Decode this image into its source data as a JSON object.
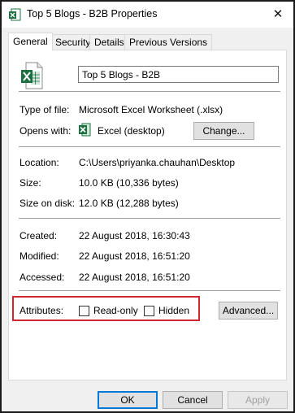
{
  "window": {
    "title": "Top 5 Blogs - B2B Properties",
    "close_glyph": "✕"
  },
  "tabs": [
    {
      "label": "General",
      "active": true
    },
    {
      "label": "Security",
      "active": false
    },
    {
      "label": "Details",
      "active": false
    },
    {
      "label": "Previous Versions",
      "active": false
    }
  ],
  "general": {
    "file_name": "Top 5 Blogs - B2B",
    "type_label": "Type of file:",
    "type_value": "Microsoft Excel Worksheet (.xlsx)",
    "opens_label": "Opens with:",
    "opens_value": "Excel (desktop)",
    "change_button": "Change...",
    "location_label": "Location:",
    "location_value": "C:\\Users\\priyanka.chauhan\\Desktop",
    "size_label": "Size:",
    "size_value": "10.0 KB (10,336 bytes)",
    "size_on_disk_label": "Size on disk:",
    "size_on_disk_value": "12.0 KB (12,288 bytes)",
    "created_label": "Created:",
    "created_value": "22 August 2018, 16:30:43",
    "modified_label": "Modified:",
    "modified_value": "22 August 2018, 16:51:20",
    "accessed_label": "Accessed:",
    "accessed_value": "22 August 2018, 16:51:20",
    "attributes_label": "Attributes:",
    "readonly_label": "Read-only",
    "readonly_checked": false,
    "hidden_label": "Hidden",
    "hidden_checked": false,
    "advanced_button": "Advanced..."
  },
  "footer": {
    "ok": "OK",
    "cancel": "Cancel",
    "apply": "Apply"
  },
  "icons": {
    "file": "excel-file-icon",
    "app": "excel-app-icon"
  },
  "colors": {
    "excel_green": "#1d6f42",
    "highlight_red": "#d0262f",
    "focus_blue": "#0078d7"
  }
}
